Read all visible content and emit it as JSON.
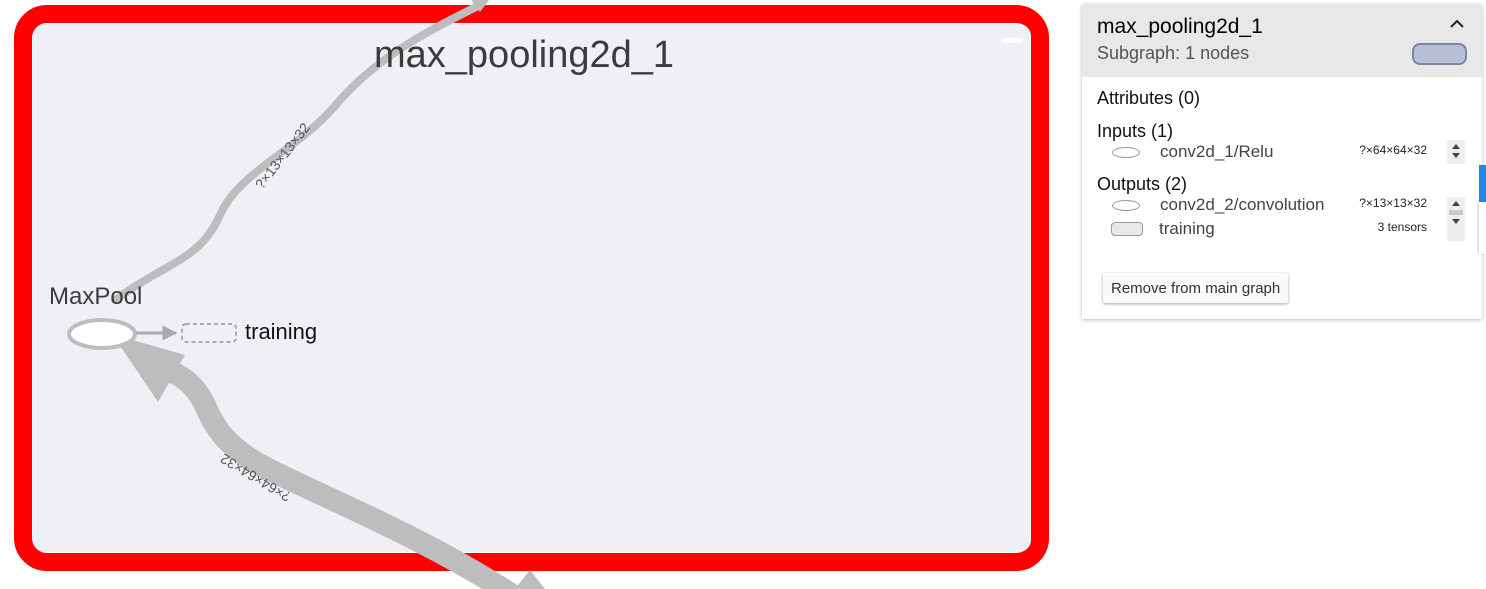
{
  "graph": {
    "group_title": "max_pooling2d_1",
    "op_name": "MaxPool",
    "aux_node_label": "training",
    "output_edge_shape": "?×13×13×32",
    "input_edge_shape": "?×64×64×32",
    "colors": {
      "selection_border": "#ff0000",
      "group_fill": "#eef0f5",
      "edge": "#bdbdbd",
      "node_stroke": "#bdbdbd"
    }
  },
  "info_panel": {
    "title": "max_pooling2d_1",
    "subtitle": "Subgraph: 1 nodes",
    "collapse_icon": "chevron-up-icon",
    "attributes_title": "Attributes (0)",
    "inputs_title": "Inputs (1)",
    "inputs": [
      {
        "name": "conv2d_1/Relu",
        "shape": "?×64×64×32"
      }
    ],
    "outputs_title": "Outputs (2)",
    "outputs": [
      {
        "name": "conv2d_2/convolution",
        "shape": "?×13×13×32"
      },
      {
        "name": "training",
        "shape": "3 tensors"
      }
    ],
    "remove_button_label": "Remove from main graph",
    "swatch_color": "#b8c0d8"
  }
}
